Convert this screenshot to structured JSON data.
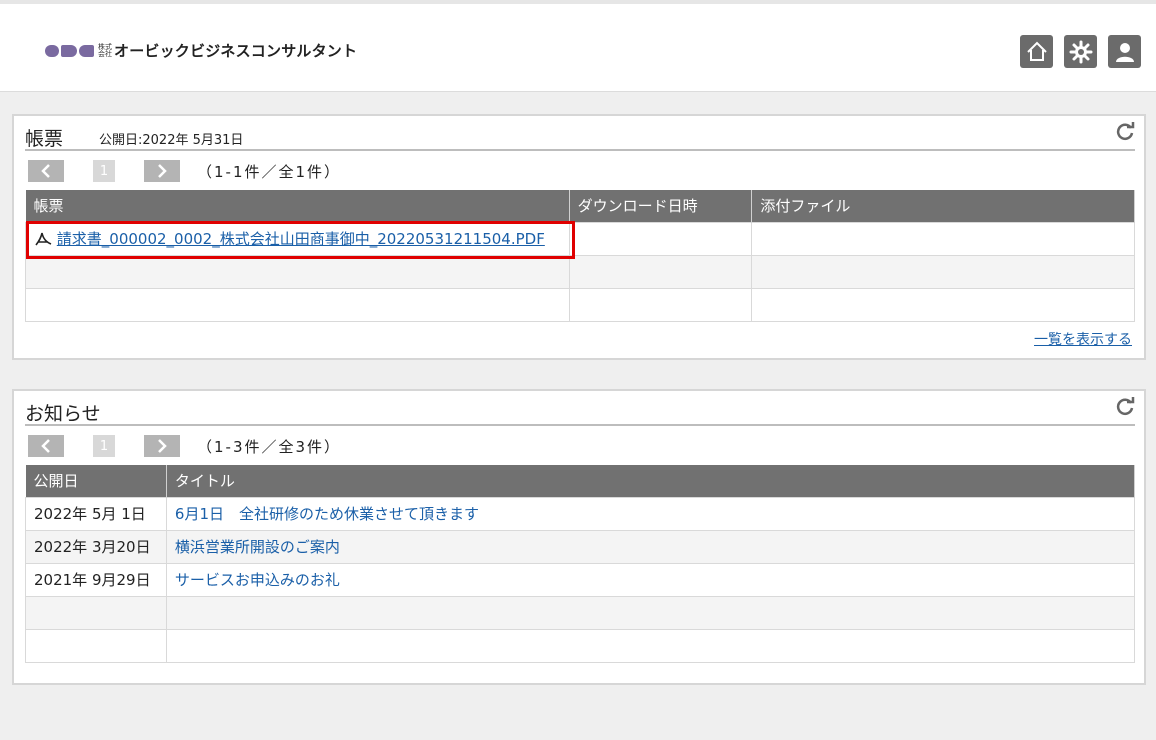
{
  "header": {
    "logo_kk": "株式会社",
    "logo_text": "オービックビジネスコンサルタント"
  },
  "colors": {
    "accent_red": "#e00000",
    "link": "#1a5fa8",
    "table_header": "#717171"
  },
  "icons": {
    "home": "home-icon",
    "settings": "gear-icon",
    "user": "user-icon",
    "refresh": "refresh-icon",
    "pdf": "pdf-icon"
  },
  "forms": {
    "title": "帳票",
    "published": "公開日:2022年 5月31日",
    "page": "1",
    "count": "（1-1件／全1件）",
    "columns": [
      "帳票",
      "ダウンロード日時",
      "添付ファイル"
    ],
    "rows": [
      {
        "file": "請求書_000002_0002_株式会社山田商事御中_20220531211504.PDF",
        "downloaded": "",
        "attachment": ""
      }
    ],
    "show_all": "一覧を表示する"
  },
  "news": {
    "title": "お知らせ",
    "page": "1",
    "count": "（1-3件／全3件）",
    "columns": [
      "公開日",
      "タイトル"
    ],
    "rows": [
      {
        "date": "2022年 5月 1日",
        "title": "6月1日　全社研修のため休業させて頂きます"
      },
      {
        "date": "2022年 3月20日",
        "title": "横浜営業所開設のご案内"
      },
      {
        "date": "2021年 9月29日",
        "title": "サービスお申込みのお礼"
      }
    ]
  }
}
